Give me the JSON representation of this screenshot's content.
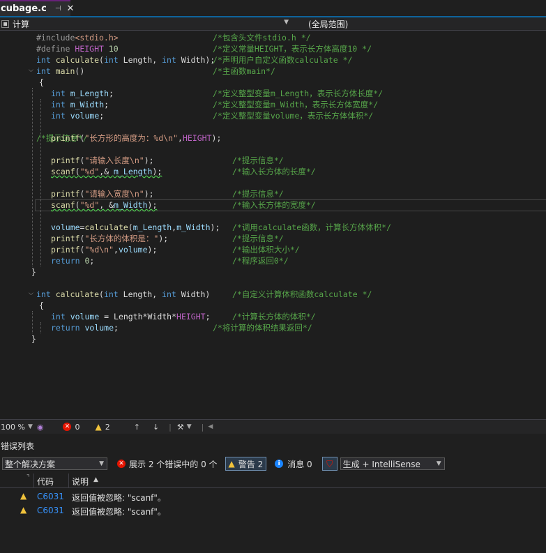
{
  "tab": {
    "title": "cubage.c",
    "pin_icon": "pin-icon",
    "close_icon": "close-icon"
  },
  "nav": {
    "left_label": "计算",
    "right_label": "(全局范围)"
  },
  "code_lines": [
    [
      [
        "pp",
        "#include"
      ],
      [
        "str",
        "<stdio.h>"
      ],
      [
        "pad",
        ""
      ],
      [
        "cm",
        "/*包含头文件stdio.h */"
      ]
    ],
    [
      [
        "pp",
        "#define "
      ],
      [
        "mac",
        "HEIGHT"
      ],
      [
        "num",
        " 10"
      ],
      [
        "cm",
        "/*定义常量HEIGHT，表示长方体高度10 */"
      ]
    ],
    [
      [
        "kw",
        "int "
      ],
      [
        "fn",
        "calculate"
      ],
      [
        "plain",
        "("
      ],
      [
        "kw",
        "int "
      ],
      [
        "plain",
        "Length, "
      ],
      [
        "kw",
        "int "
      ],
      [
        "plain",
        "Width);"
      ],
      [
        "cm",
        "/*声明用户自定义函数calculate */"
      ]
    ],
    [
      [
        "kw",
        "int "
      ],
      [
        "fn",
        "main"
      ],
      [
        "plain",
        "()"
      ],
      [
        "cm",
        "/*主函数main*/"
      ]
    ],
    [
      [
        "plain",
        "{"
      ]
    ],
    [
      [
        "kw",
        "int "
      ],
      [
        "var",
        "m_Length"
      ],
      [
        "plain",
        ";"
      ],
      [
        "cm",
        "/*定义整型变量m_Length，表示长方体长度*/"
      ]
    ],
    [
      [
        "kw",
        "int "
      ],
      [
        "var",
        "m_Width"
      ],
      [
        "plain",
        ";"
      ],
      [
        "cm",
        "/*定义整型变量m_Width，表示长方体宽度*/"
      ]
    ],
    [
      [
        "kw",
        "int "
      ],
      [
        "var",
        "volume"
      ],
      [
        "plain",
        ";"
      ],
      [
        "cm",
        "/*定义整型变量volume，表示长方体体积*/"
      ]
    ],
    [],
    [
      [
        "fn",
        "printf"
      ],
      [
        "plain",
        "("
      ],
      [
        "str",
        "\"长方形的高度为：%d\\n\""
      ],
      [
        "plain",
        ","
      ],
      [
        "mac",
        "HEIGHT"
      ],
      [
        "plain",
        ");"
      ],
      [
        "cm",
        "/*提示信息*/"
      ]
    ],
    [],
    [
      [
        "fn",
        "printf"
      ],
      [
        "plain",
        "("
      ],
      [
        "str",
        "\"请输入长度\\n\""
      ],
      [
        "plain",
        ");"
      ],
      [
        "cm",
        "/*提示信息*/"
      ]
    ],
    [
      [
        "fn",
        "scanf"
      ],
      [
        "plain",
        "("
      ],
      [
        "str",
        "\"%d\""
      ],
      [
        "plain",
        ",& "
      ],
      [
        "var",
        "m_Length"
      ],
      [
        "plain",
        ");"
      ],
      [
        "cm",
        "/*输入长方体的长度*/"
      ]
    ],
    [],
    [
      [
        "fn",
        "printf"
      ],
      [
        "plain",
        "("
      ],
      [
        "str",
        "\"请输入宽度\\n\""
      ],
      [
        "plain",
        ");"
      ],
      [
        "cm",
        "/*提示信息*/"
      ]
    ],
    [
      [
        "fn",
        "scanf"
      ],
      [
        "plain",
        "("
      ],
      [
        "str",
        "\"%d\""
      ],
      [
        "plain",
        ", &"
      ],
      [
        "var",
        "m_Width"
      ],
      [
        "plain",
        ");"
      ],
      [
        "cm",
        "/*输入长方体的宽度*/"
      ]
    ],
    [],
    [
      [
        "var",
        "volume"
      ],
      [
        "plain",
        "="
      ],
      [
        "fn",
        "calculate"
      ],
      [
        "plain",
        "("
      ],
      [
        "var",
        "m_Length"
      ],
      [
        "plain",
        ","
      ],
      [
        "var",
        "m_Width"
      ],
      [
        "plain",
        ");"
      ],
      [
        "cm",
        "/*调用calculate函数，计算长方体体积*/"
      ]
    ],
    [
      [
        "fn",
        "printf"
      ],
      [
        "plain",
        "("
      ],
      [
        "str",
        "\"长方体的体积是：\""
      ],
      [
        "plain",
        ");"
      ],
      [
        "cm",
        "/*提示信息*/"
      ]
    ],
    [
      [
        "fn",
        "printf"
      ],
      [
        "plain",
        "("
      ],
      [
        "str",
        "\"%d\\n\""
      ],
      [
        "plain",
        ","
      ],
      [
        "var",
        "volume"
      ],
      [
        "plain",
        ");"
      ],
      [
        "cm",
        "/*输出体积大小*/"
      ]
    ],
    [
      [
        "kw",
        "return "
      ],
      [
        "num",
        "0"
      ],
      [
        "plain",
        ";"
      ],
      [
        "cm",
        "/*程序返回0*/"
      ]
    ],
    [
      [
        "plain",
        "}"
      ]
    ],
    [],
    [
      [
        "kw",
        "int "
      ],
      [
        "fn",
        "calculate"
      ],
      [
        "plain",
        "("
      ],
      [
        "kw",
        "int "
      ],
      [
        "plain",
        "Length, "
      ],
      [
        "kw",
        "int "
      ],
      [
        "plain",
        "Width)"
      ],
      [
        "cm",
        "/*自定义计算体积函数calculate */"
      ]
    ],
    [
      [
        "plain",
        "{"
      ]
    ],
    [
      [
        "kw",
        "int "
      ],
      [
        "var",
        "volume"
      ],
      [
        "plain",
        " = Length*Width*"
      ],
      [
        "mac",
        "HEIGHT"
      ],
      [
        "plain",
        ";"
      ],
      [
        "cm",
        "/*计算长方体的体积*/"
      ]
    ],
    [
      [
        "kw",
        "return "
      ],
      [
        "var",
        "volume"
      ],
      [
        "plain",
        ";"
      ],
      [
        "cm",
        "/*将计算的体积结果返回*/"
      ]
    ],
    [
      [
        "plain",
        "}"
      ]
    ]
  ],
  "status": {
    "zoom": "100 %",
    "errors": "0",
    "warnings": "2"
  },
  "error_list": {
    "title": "错误列表",
    "scope": "整个解决方案",
    "errors_btn": "展示 2 个错误中的 0 个",
    "warnings_btn": "警告 2",
    "messages_btn": "消息 0",
    "build_filter": "生成 + IntelliSense",
    "col_code": "代码",
    "col_desc": "说明",
    "rows": [
      {
        "code": "C6031",
        "desc": "返回值被忽略: \"scanf\"。"
      },
      {
        "code": "C6031",
        "desc": "返回值被忽略: \"scanf\"。"
      }
    ]
  }
}
